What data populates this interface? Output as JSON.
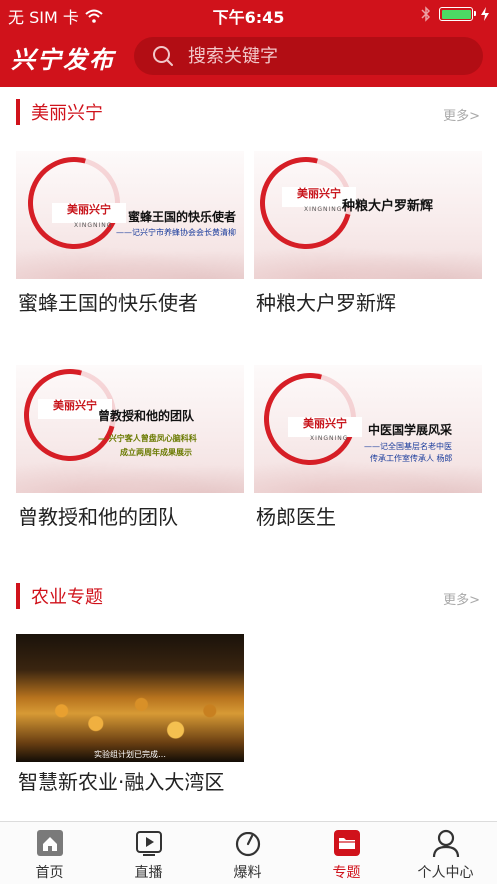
{
  "status_bar": {
    "carrier": "无 SIM 卡",
    "time": "下午6:45"
  },
  "header": {
    "app_title": "兴宁发布",
    "search_placeholder": "搜索关键字"
  },
  "sections": [
    {
      "title": "美丽兴宁",
      "more": "更多>",
      "items": [
        {
          "title": "蜜蜂王国的快乐使者",
          "thumb_logo": "美丽兴宁",
          "thumb_logo_sub": "XINGNING",
          "thumb_headline": "蜜蜂王国的快乐使者",
          "thumb_sub1": "——记兴宁市养蜂协会会长黄清柳",
          "thumb_sub2": ""
        },
        {
          "title": "种粮大户罗新辉",
          "thumb_logo": "美丽兴宁",
          "thumb_logo_sub": "XINGNING",
          "thumb_headline": "种粮大户罗新辉",
          "thumb_sub1": "",
          "thumb_sub2": ""
        },
        {
          "title": "曾教授和他的团队",
          "thumb_logo": "美丽兴宁",
          "thumb_logo_sub": "",
          "thumb_headline": "曾教授和他的团队",
          "thumb_sub1": "— 兴宁客人曾盘凤心脑科科",
          "thumb_sub2": "成立两周年成果展示"
        },
        {
          "title": "杨郎医生",
          "thumb_logo": "美丽兴宁",
          "thumb_logo_sub": "XINGNING",
          "thumb_headline": "中医国学展风采",
          "thumb_sub1": "——记全国基层名老中医",
          "thumb_sub2": "传承工作室传承人 杨郎"
        }
      ]
    },
    {
      "title": "农业专题",
      "more": "更多>",
      "items": [
        {
          "title": "智慧新农业·融入大湾区",
          "thumb_caption": "实验组计划已完成…"
        }
      ]
    }
  ],
  "tabbar": {
    "items": [
      {
        "label": "首页",
        "icon": "home-icon",
        "active": false
      },
      {
        "label": "直播",
        "icon": "live-icon",
        "active": false
      },
      {
        "label": "爆料",
        "icon": "report-icon",
        "active": false
      },
      {
        "label": "专题",
        "icon": "folder-icon",
        "active": true
      },
      {
        "label": "个人中心",
        "icon": "user-icon",
        "active": false
      }
    ]
  },
  "colors": {
    "brand_red": "#d0121b",
    "search_bg": "#b20d14",
    "battery_green": "#4cd964"
  }
}
